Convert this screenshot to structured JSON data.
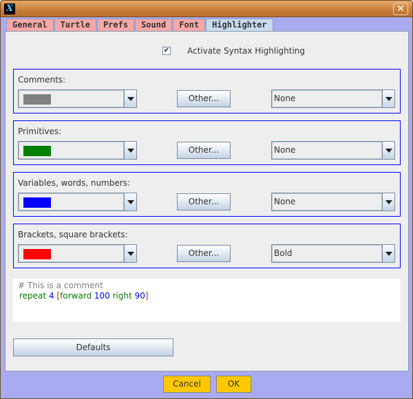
{
  "window": {
    "close_label": "✕",
    "icon": "x-app-icon"
  },
  "tabs": [
    {
      "label": "General"
    },
    {
      "label": "Turtle"
    },
    {
      "label": "Prefs"
    },
    {
      "label": "Sound"
    },
    {
      "label": "Font"
    },
    {
      "label": "Highlighter",
      "selected": true
    }
  ],
  "activate": {
    "label": "Activate Syntax Highlighting",
    "checked": true,
    "mark": "✔"
  },
  "groups": [
    {
      "label": "Comments:",
      "color": "#808080",
      "other": "Other...",
      "style": "None"
    },
    {
      "label": "Primitives:",
      "color": "#008000",
      "other": "Other...",
      "style": "None"
    },
    {
      "label": "Variables, words, numbers:",
      "color": "#0000ff",
      "other": "Other...",
      "style": "None"
    },
    {
      "label": "Brackets, square brackets:",
      "color": "#ff0000",
      "other": "Other...",
      "style": "Bold"
    }
  ],
  "preview": {
    "comment": "# This is a comment",
    "tokens": [
      {
        "t": "repeat ",
        "c": "#008000"
      },
      {
        "t": "4 ",
        "c": "#0000ff"
      },
      {
        "t": "[",
        "c": "#ff0000"
      },
      {
        "t": "forward ",
        "c": "#008000"
      },
      {
        "t": "100 ",
        "c": "#0000ff"
      },
      {
        "t": "right ",
        "c": "#008000"
      },
      {
        "t": "90",
        "c": "#0000ff"
      },
      {
        "t": "]",
        "c": "#ff0000"
      }
    ]
  },
  "defaults_label": "Defaults",
  "cancel_label": "Cancel",
  "ok_label": "OK"
}
